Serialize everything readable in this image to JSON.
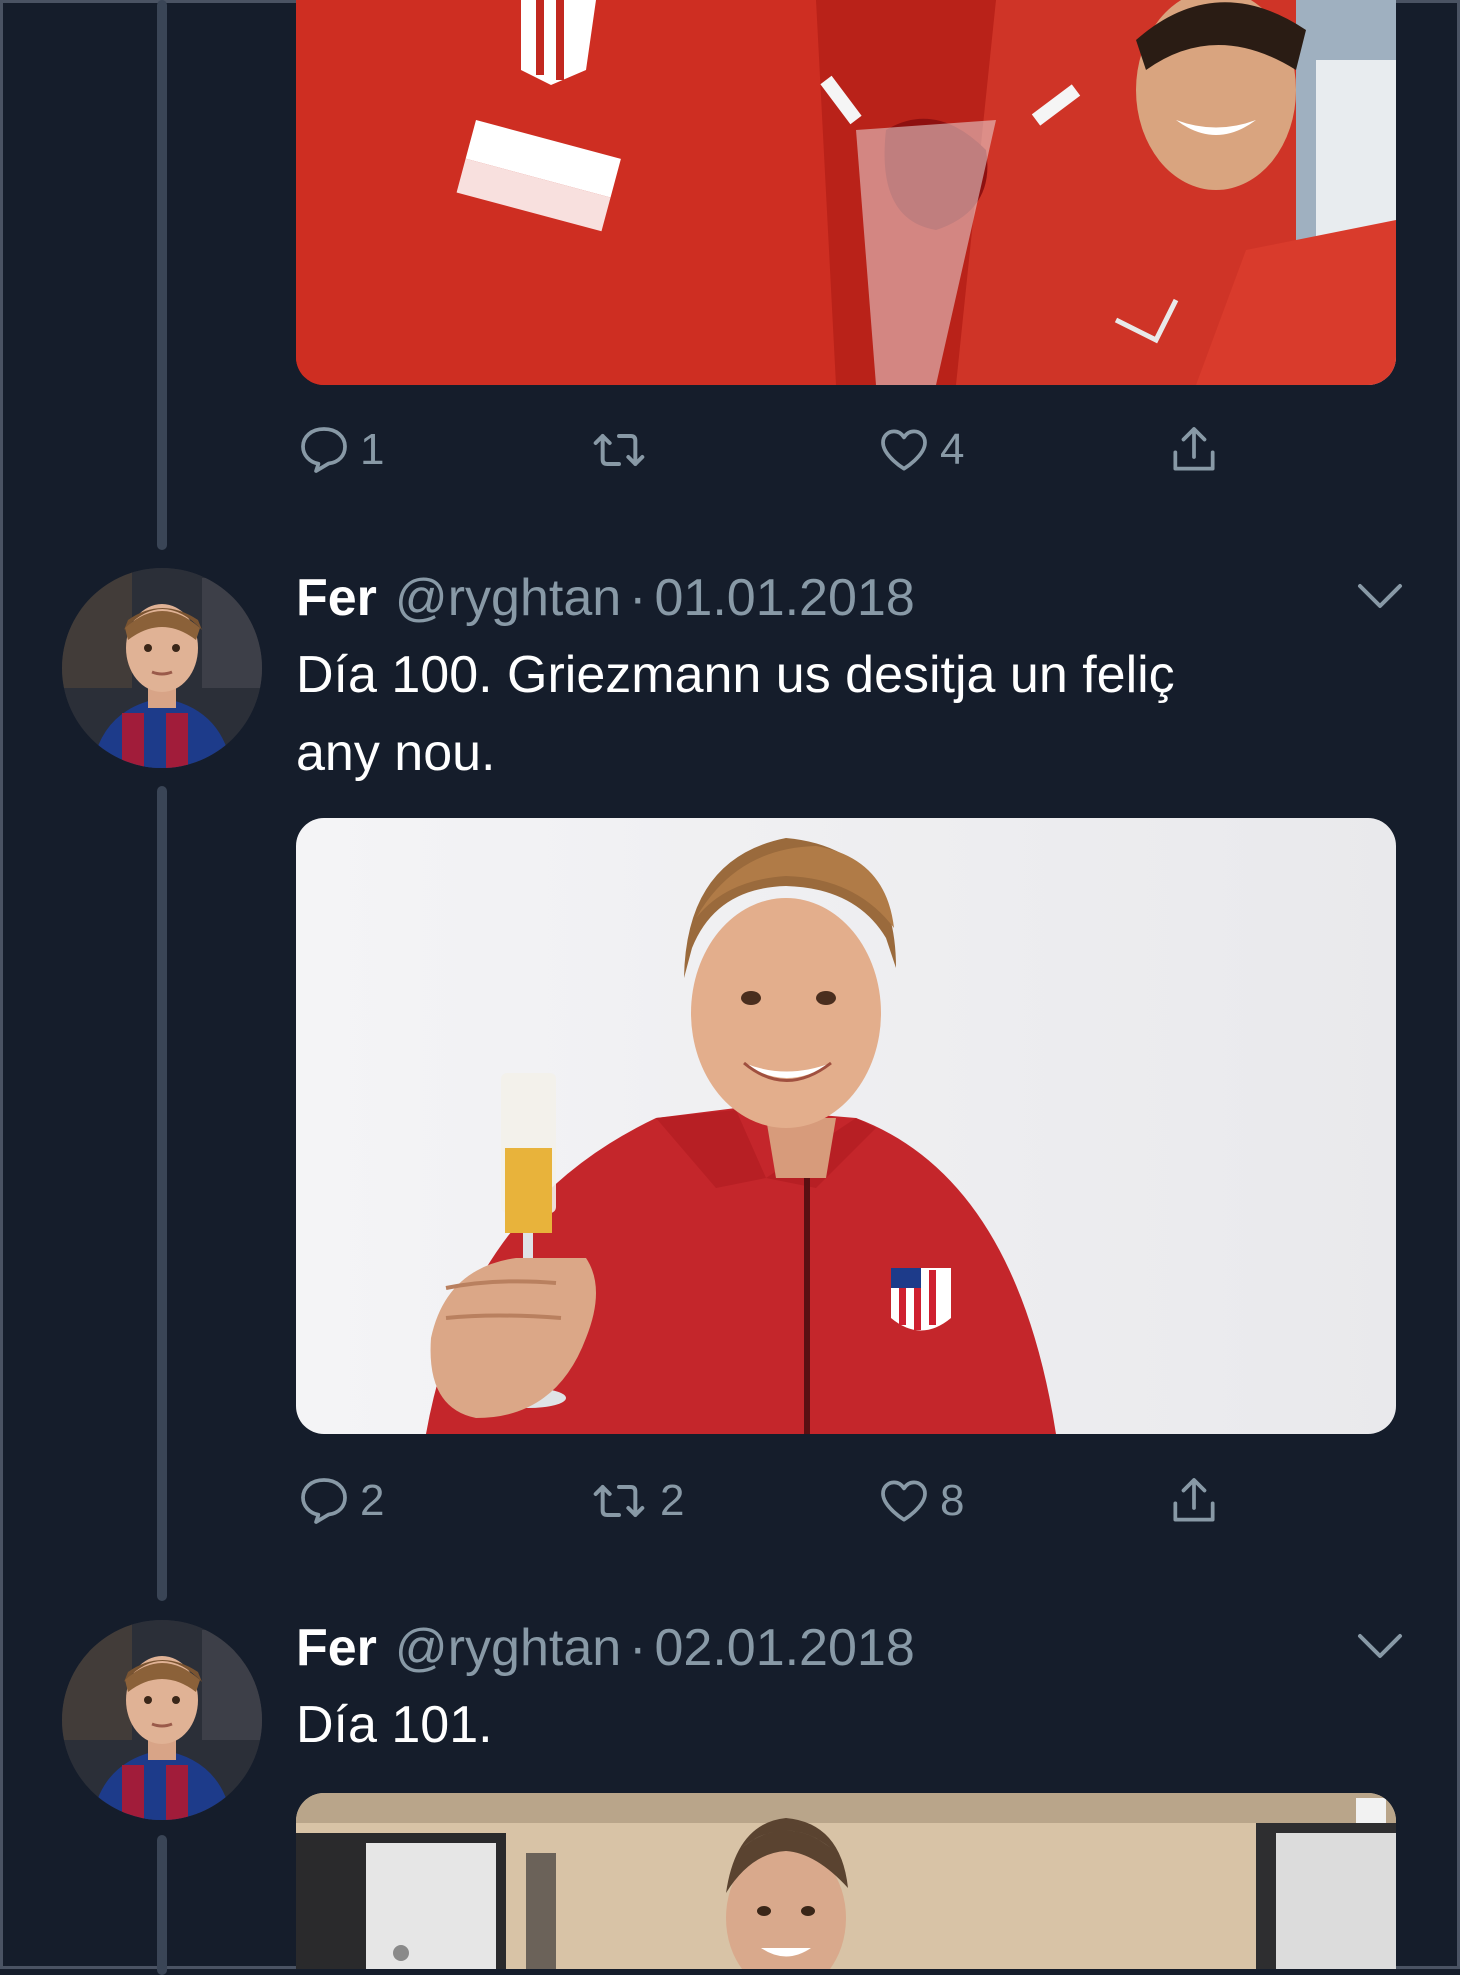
{
  "theme": {
    "background": "#151d2b",
    "thread_line": "#3a4556",
    "secondary_text": "#8899a6",
    "primary_text": "#ffffff"
  },
  "tweets": [
    {
      "id": "tweet-0",
      "image_description": "Atletico de Madrid players in red tracksuits, one smiling holding a red rose",
      "actions": {
        "reply_count": "1",
        "retweet_count": "",
        "like_count": "4"
      }
    },
    {
      "id": "tweet-1",
      "author": {
        "name": "Fer",
        "handle": "@ryghtan"
      },
      "separator": "·",
      "date": "01.01.2018",
      "text_line1": "Día 100. Griezmann us desitja un feliç",
      "text_line2": "any nou.",
      "actions": {
        "reply_count": "2",
        "retweet_count": "2",
        "like_count": "8"
      }
    },
    {
      "id": "tweet-2",
      "author": {
        "name": "Fer",
        "handle": "@ryghtan"
      },
      "separator": "·",
      "date": "02.01.2018",
      "text_line1": "Día 101."
    }
  ],
  "icons": {
    "reply": "reply-icon",
    "retweet": "retweet-icon",
    "like": "heart-icon",
    "share": "share-icon",
    "more": "chevron-down-icon"
  }
}
